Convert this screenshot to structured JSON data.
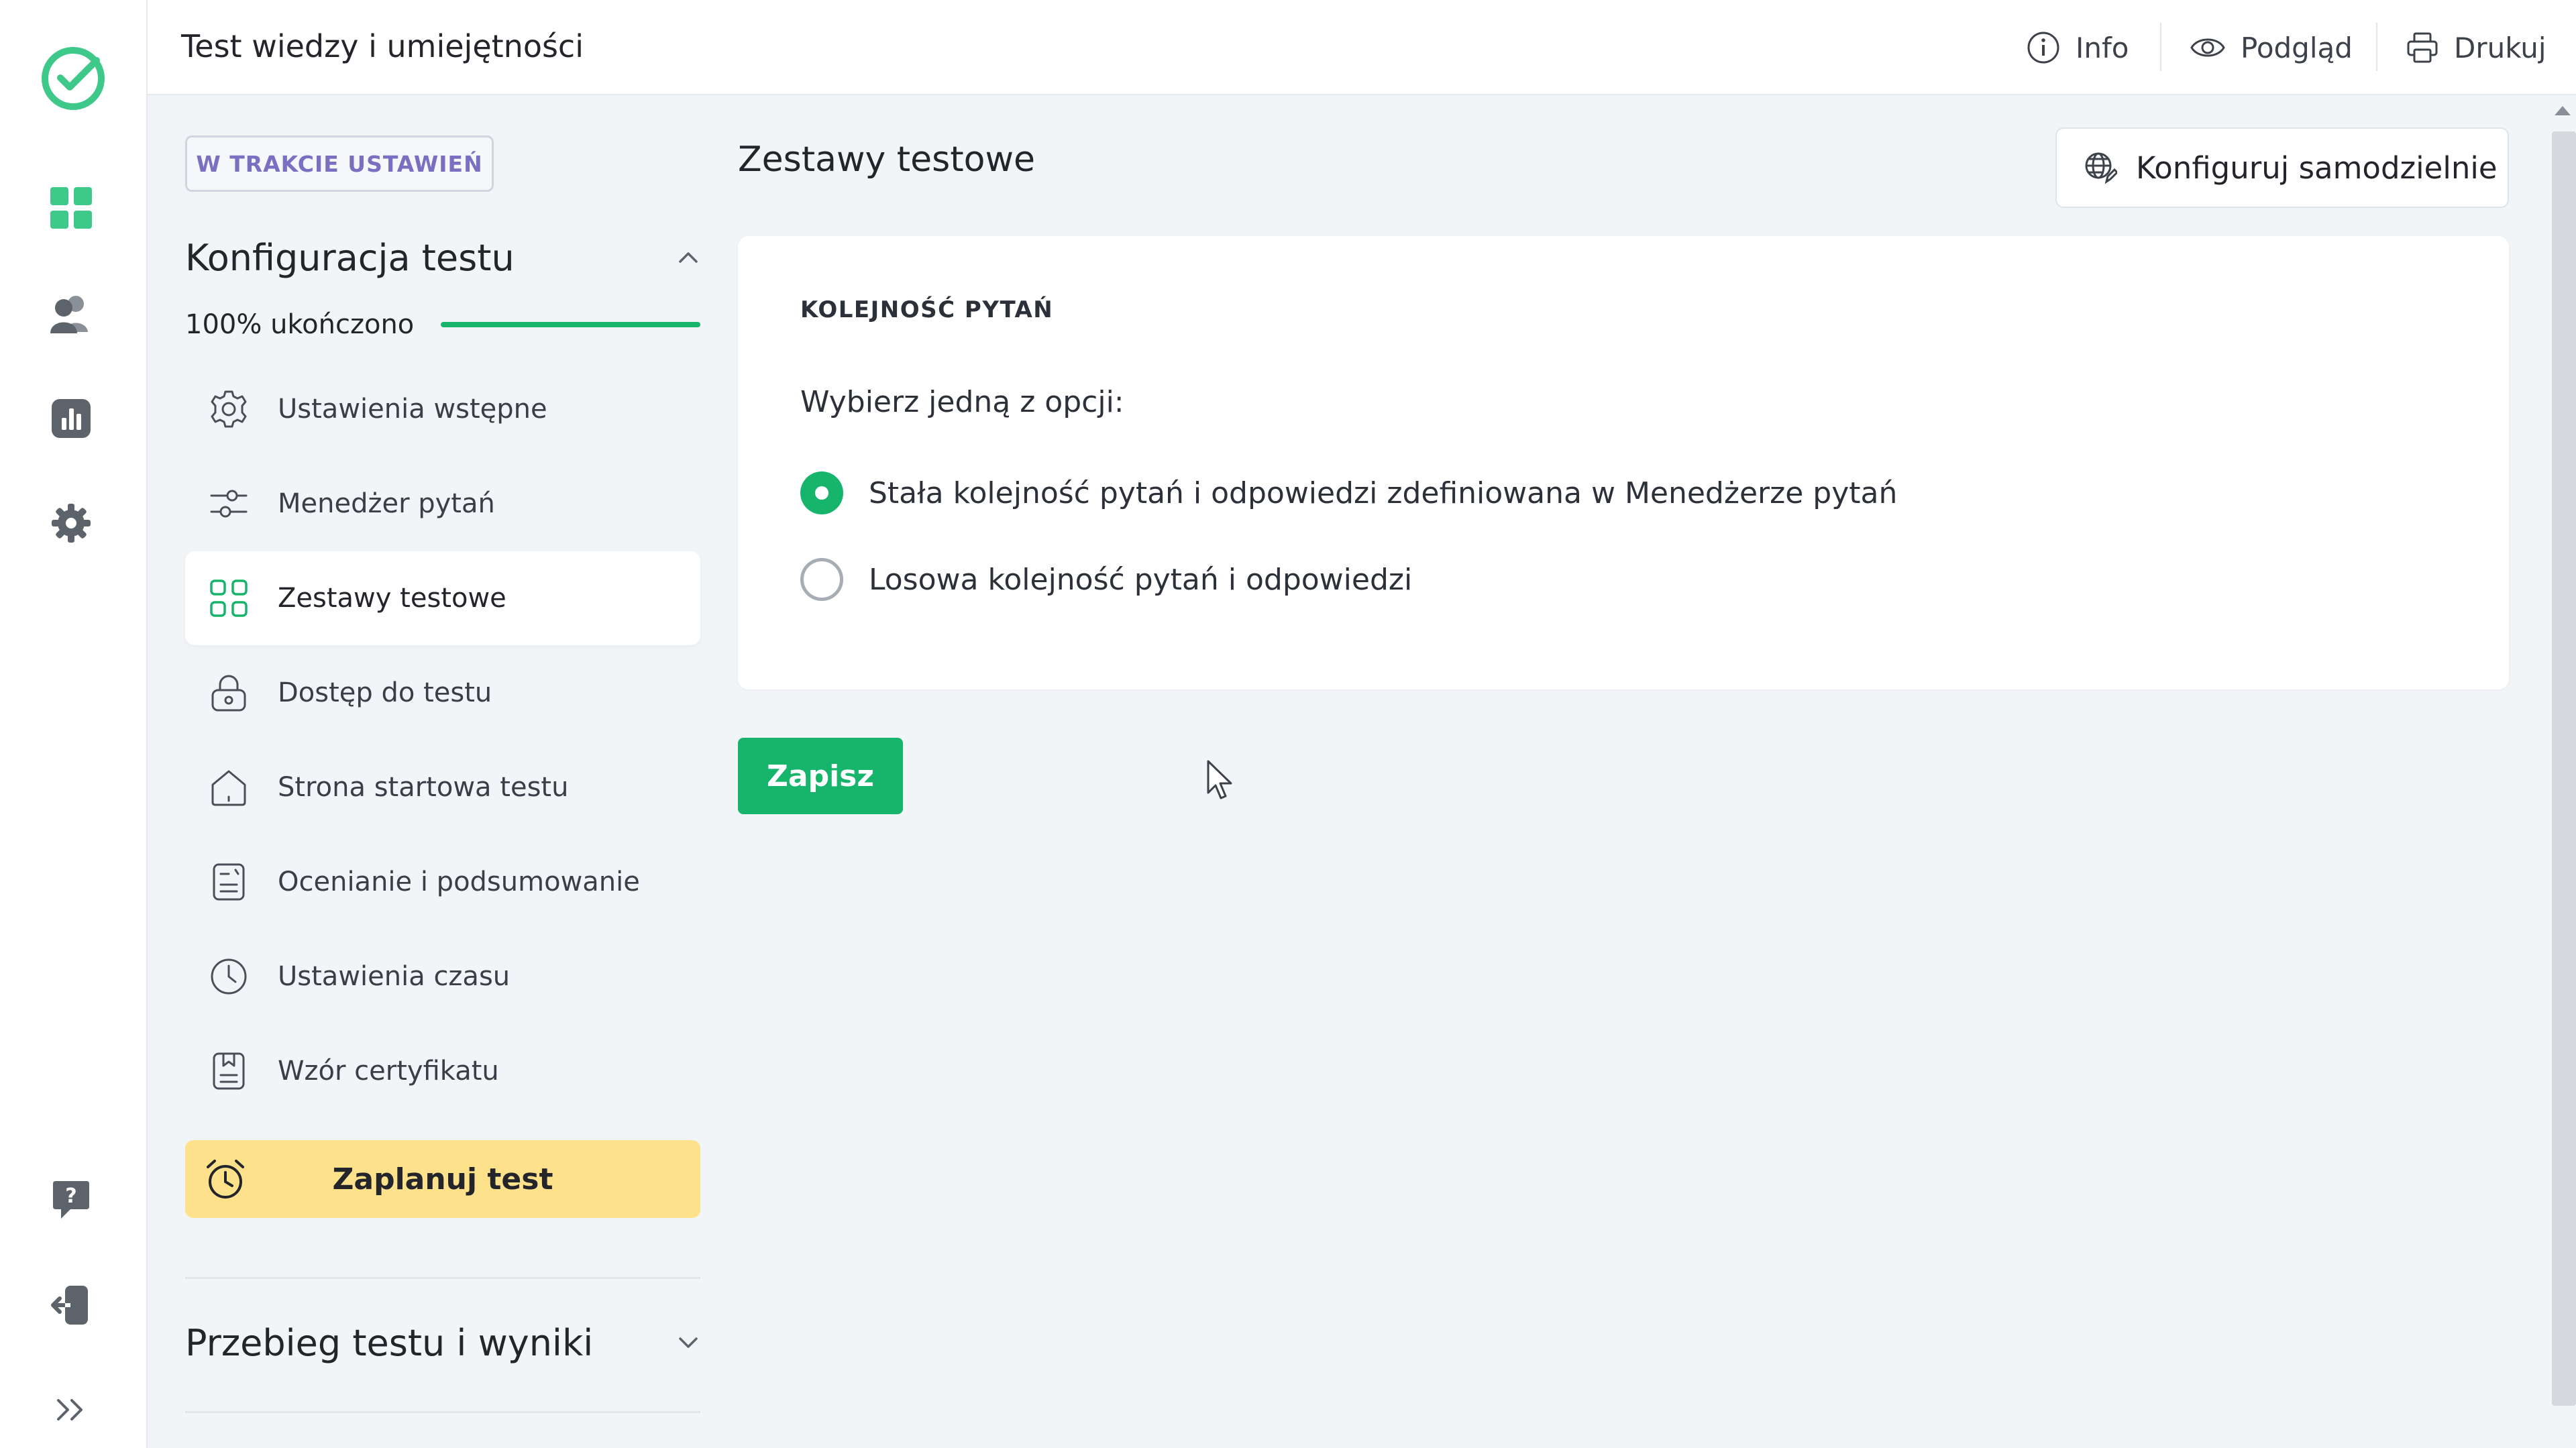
{
  "app": {
    "title": "Test wiedzy i umiejętności",
    "accent_color": "#16b56b"
  },
  "rail": {
    "icons": [
      "logo-check-icon",
      "dashboard-grid-icon",
      "users-icon",
      "reports-chart-icon",
      "settings-gear-icon",
      "help-question-icon",
      "logout-icon",
      "expand-chevrons-icon"
    ]
  },
  "topbar": {
    "info_label": "Info",
    "preview_label": "Podgląd",
    "print_label": "Drukuj"
  },
  "sidebar": {
    "status_badge": "W TRAKCIE USTAWIEŃ",
    "section_config_title": "Konfiguracja testu",
    "progress_label": "100% ukończono",
    "progress_fraction": 1.0,
    "items": [
      {
        "label": "Ustawienia wstępne",
        "icon": "gear-outline-icon"
      },
      {
        "label": "Menedżer pytań",
        "icon": "sliders-icon"
      },
      {
        "label": "Zestawy testowe",
        "icon": "grid-squares-icon",
        "active": true
      },
      {
        "label": "Dostęp do testu",
        "icon": "lock-icon"
      },
      {
        "label": "Strona startowa testu",
        "icon": "home-icon"
      },
      {
        "label": "Ocenianie i podsumowanie",
        "icon": "document-grade-icon"
      },
      {
        "label": "Ustawienia czasu",
        "icon": "clock-icon"
      },
      {
        "label": "Wzór certyfikatu",
        "icon": "certificate-icon"
      }
    ],
    "schedule_label": "Zaplanuj test",
    "section_results_title": "Przebieg testu i wyniki"
  },
  "main": {
    "page_title": "Zestawy testowe",
    "config_button_label": "Konfiguruj samodzielnie",
    "card_heading": "KOLEJNOŚĆ PYTAŃ",
    "card_prompt": "Wybierz jedną z opcji:",
    "options": [
      {
        "label": "Stała kolejność pytań i odpowiedzi zdefiniowana w Menedżerze pytań",
        "selected": true
      },
      {
        "label": "Losowa kolejność pytań i odpowiedzi",
        "selected": false
      }
    ],
    "save_label": "Zapisz"
  }
}
